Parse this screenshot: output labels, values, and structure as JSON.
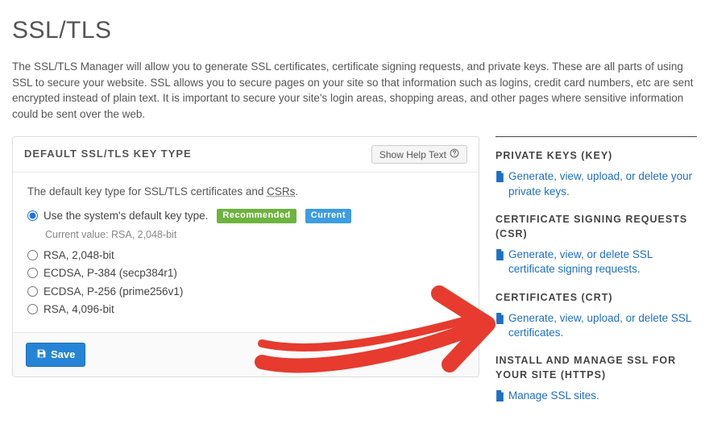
{
  "page": {
    "title": "SSL/TLS",
    "intro": "The SSL/TLS Manager will allow you to generate SSL certificates, certificate signing requests, and private keys. These are all parts of using SSL to secure your website. SSL allows you to secure pages on your site so that information such as logins, credit card numbers, etc are sent encrypted instead of plain text. It is important to secure your site's login areas, shopping areas, and other pages where sensitive information could be sent over the web."
  },
  "panel": {
    "title": "DEFAULT SSL/TLS KEY TYPE",
    "help_label": "Show Help Text",
    "desc_prefix": "The default key type for SSL/TLS certificates and ",
    "desc_abbr": "CSRs",
    "desc_abbr_title": "Certificate Signing Requests",
    "options": {
      "0": {
        "label": "Use the system's default key type.",
        "checked": true,
        "recommended": true,
        "current": true,
        "sub": "Current value: RSA, 2,048-bit"
      },
      "1": {
        "label": "RSA, 2,048-bit"
      },
      "2": {
        "label": "ECDSA, P-384 (secp384r1)"
      },
      "3": {
        "label": "ECDSA, P-256 (prime256v1)"
      },
      "4": {
        "label": "RSA, 4,096-bit"
      }
    },
    "badges": {
      "recommended": "Recommended",
      "current": "Current"
    },
    "save_label": "Save"
  },
  "sidebar": {
    "sections": {
      "keys": {
        "heading": "PRIVATE KEYS (KEY)",
        "link": "Generate, view, upload, or delete your private keys."
      },
      "csr": {
        "heading": "CERTIFICATE SIGNING REQUESTS (CSR)",
        "link": "Generate, view, or delete SSL certificate signing requests."
      },
      "crt": {
        "heading": "CERTIFICATES (CRT)",
        "link": "Generate, view, upload, or delete SSL certificates."
      },
      "install": {
        "heading": "INSTALL AND MANAGE SSL FOR YOUR SITE (HTTPS)",
        "link": "Manage SSL sites."
      }
    }
  }
}
